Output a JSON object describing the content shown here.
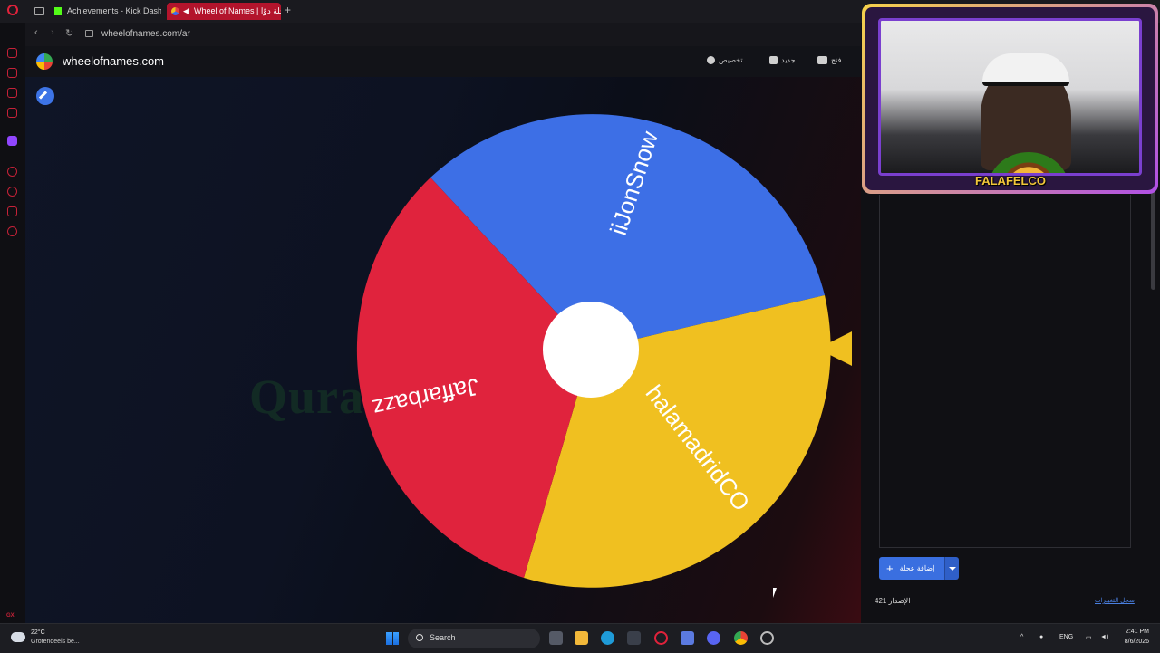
{
  "browser": {
    "tabs": [
      {
        "label": "Achievements - Kick Dashb"
      },
      {
        "label": "Wheel of Names | عجلة دوّا"
      }
    ],
    "new_tab": "+",
    "url": "wheelofnames.com/ar"
  },
  "site": {
    "name": "wheelofnames.com",
    "header_items": [
      "تخصيص",
      "جديد",
      "فتح"
    ]
  },
  "wheel": {
    "segments": [
      {
        "name": "iiJonSnow",
        "color": "#3d6fe6"
      },
      {
        "name": "halamadridCO",
        "color": "#f0c020"
      },
      {
        "name": "Jaffarbazz",
        "color": "#e0233d"
      }
    ]
  },
  "overlay_text": "Quranco is now following!",
  "webcam": {
    "logo_text": "FALAFELCO"
  },
  "panel": {
    "add_button": "إضافة عجلة",
    "version_label": "الإصدار",
    "version_number": "421",
    "changelog": "سجل التغييرات"
  },
  "taskbar": {
    "weather_temp": "22°C",
    "weather_desc": "Grotendeels be...",
    "search": "Search",
    "language": "ENG",
    "time": "2:41 PM",
    "date": "8/6/2026"
  },
  "sidebar": {
    "gx_label": "GX"
  }
}
